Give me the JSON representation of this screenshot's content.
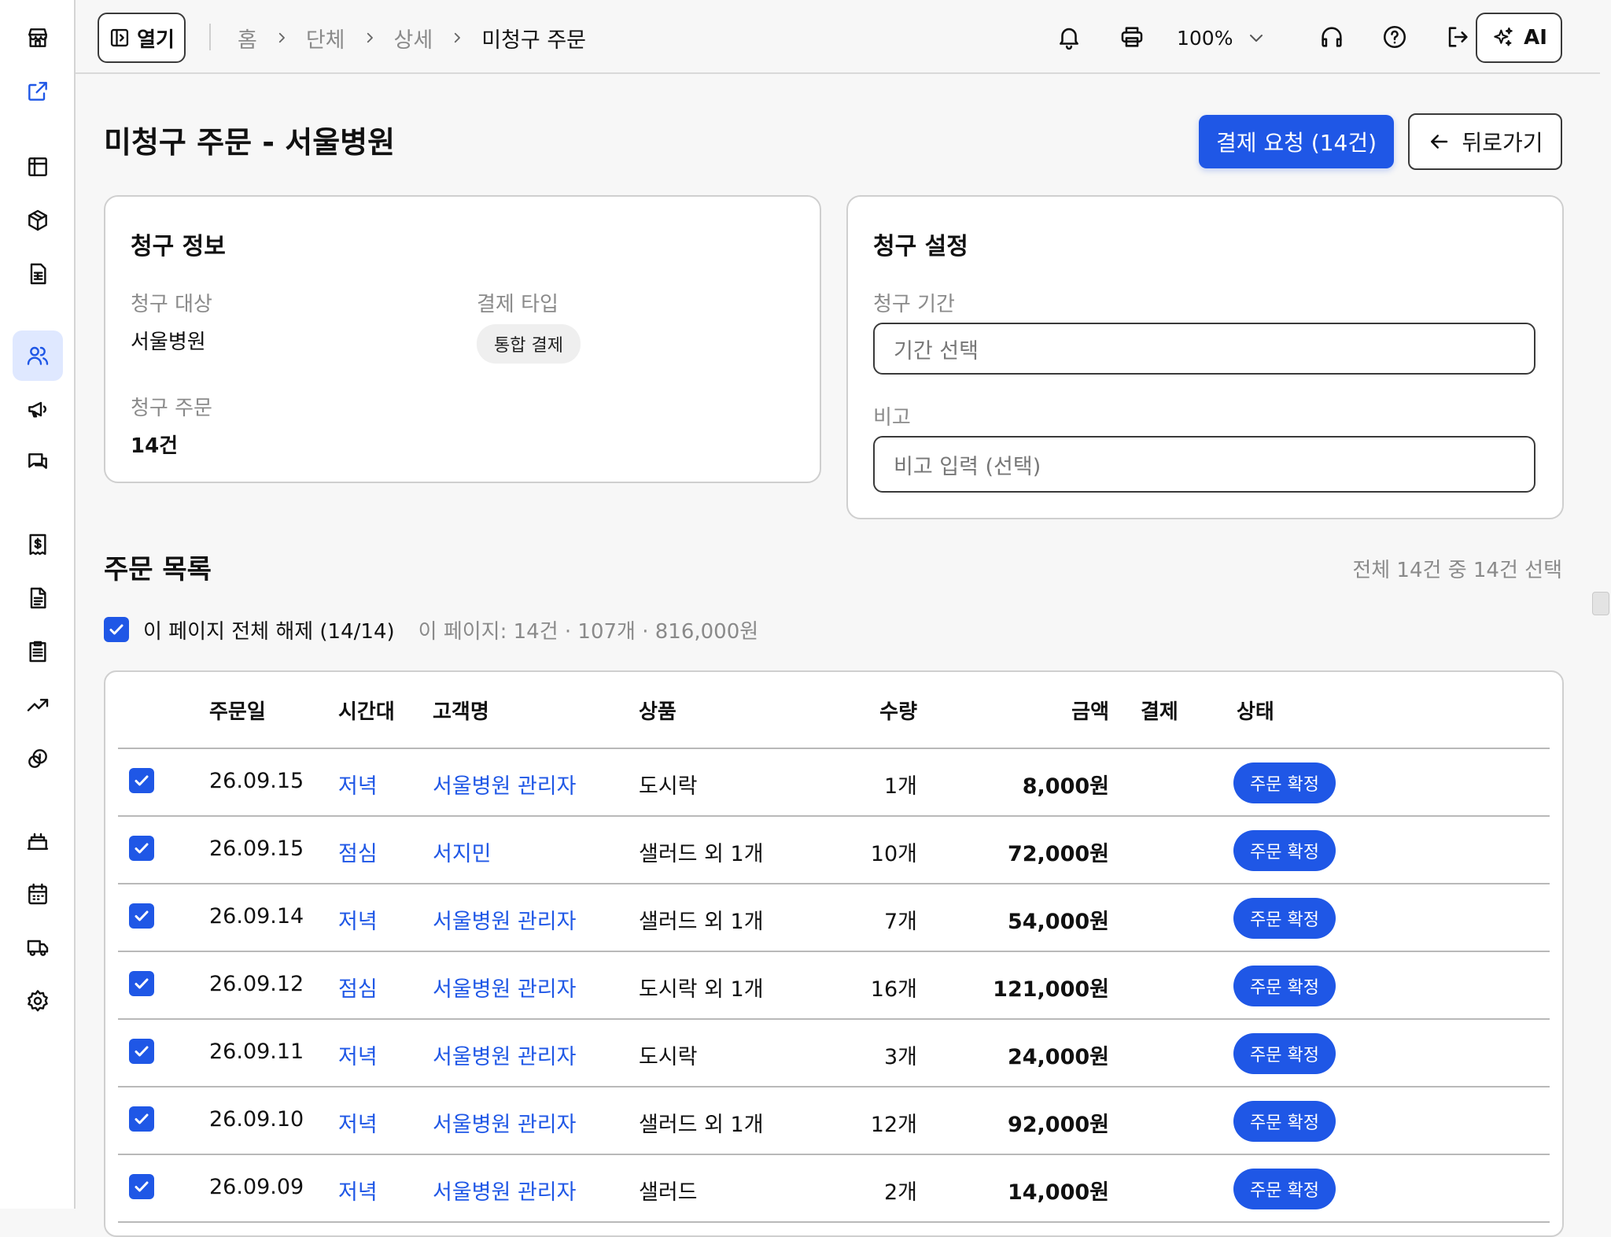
{
  "topbar": {
    "open_label": "열기",
    "breadcrumbs": [
      "홈",
      "단체",
      "상세",
      "미청구 주문"
    ],
    "zoom": "100%",
    "ai_label": "AI"
  },
  "page": {
    "title": "미청구 주문 - 서울병원",
    "pay_button": "결제 요청 (14건)",
    "back_button": "뒤로가기"
  },
  "billing_info": {
    "title": "청구 정보",
    "target_label": "청구 대상",
    "target_value": "서울병원",
    "pay_type_label": "결제 타입",
    "pay_type_value": "통합 결제",
    "orders_label": "청구 주문",
    "orders_value": "14건"
  },
  "billing_settings": {
    "title": "청구 설정",
    "period_label": "청구 기간",
    "period_placeholder": "기간 선택",
    "note_label": "비고",
    "note_placeholder": "비고 입력 (선택)"
  },
  "orders": {
    "title": "주문 목록",
    "count_text": "전체 14건 중 14건 선택",
    "select_all_label": "이 페이지 전체 해제 (14/14)",
    "page_summary": "이 페이지: 14건 · 107개 · 816,000원",
    "columns": [
      "주문일",
      "시간대",
      "고객명",
      "상품",
      "수량",
      "금액",
      "결제",
      "상태"
    ],
    "rows": [
      {
        "date": "26.09.15",
        "slot": "저녁",
        "customer": "서울병원 관리자",
        "product": "도시락",
        "qty": "1개",
        "amount": "8,000원",
        "payment": "",
        "status": "주문 확정"
      },
      {
        "date": "26.09.15",
        "slot": "점심",
        "customer": "서지민",
        "product": "샐러드 외 1개",
        "qty": "10개",
        "amount": "72,000원",
        "payment": "",
        "status": "주문 확정"
      },
      {
        "date": "26.09.14",
        "slot": "저녁",
        "customer": "서울병원 관리자",
        "product": "샐러드 외 1개",
        "qty": "7개",
        "amount": "54,000원",
        "payment": "",
        "status": "주문 확정"
      },
      {
        "date": "26.09.12",
        "slot": "점심",
        "customer": "서울병원 관리자",
        "product": "도시락 외 1개",
        "qty": "16개",
        "amount": "121,000원",
        "payment": "",
        "status": "주문 확정"
      },
      {
        "date": "26.09.11",
        "slot": "저녁",
        "customer": "서울병원 관리자",
        "product": "도시락",
        "qty": "3개",
        "amount": "24,000원",
        "payment": "",
        "status": "주문 확정"
      },
      {
        "date": "26.09.10",
        "slot": "저녁",
        "customer": "서울병원 관리자",
        "product": "샐러드 외 1개",
        "qty": "12개",
        "amount": "92,000원",
        "payment": "",
        "status": "주문 확정"
      },
      {
        "date": "26.09.09",
        "slot": "저녁",
        "customer": "서울병원 관리자",
        "product": "샐러드",
        "qty": "2개",
        "amount": "14,000원",
        "payment": "",
        "status": "주문 확정"
      }
    ]
  },
  "colors": {
    "primary": "#1f57e6",
    "active_rail_bg": "#dfe8ff"
  },
  "sidebar_icons": [
    "store-icon",
    "external-link-icon",
    "table-icon",
    "box-icon",
    "spreadsheet-icon",
    "users-icon",
    "megaphone-icon",
    "chat-icon",
    "receipt-dollar-icon",
    "document-icon",
    "clipboard-list-icon",
    "trending-up-icon",
    "coins-icon",
    "cake-icon",
    "calendar-icon",
    "truck-icon",
    "settings-icon"
  ]
}
